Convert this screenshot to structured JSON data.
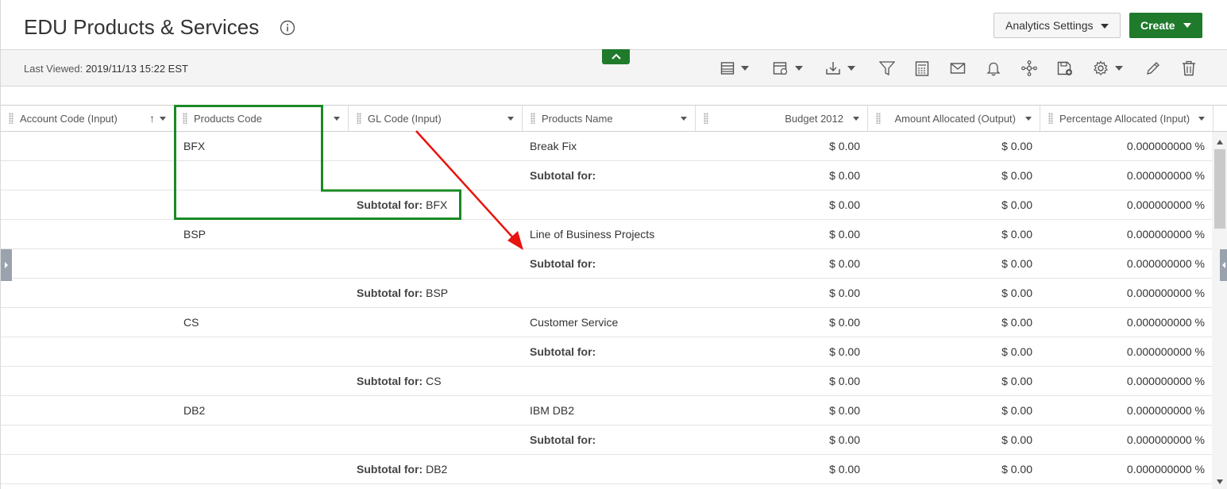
{
  "header": {
    "title": "EDU Products & Services",
    "analytics_label": "Analytics Settings",
    "create_label": "Create"
  },
  "toolbar": {
    "last_viewed_label": "Last Viewed:",
    "last_viewed_value": "2019/11/13 15:22 EST",
    "icons": [
      "table-view-icon",
      "report-view-icon",
      "download-icon",
      "filter-icon",
      "calculator-icon",
      "email-icon",
      "bell-icon",
      "hierarchy-icon",
      "save-icon",
      "gear-icon",
      "pencil-icon",
      "trash-icon"
    ]
  },
  "columns": [
    {
      "label": "Account Code (Input)"
    },
    {
      "label": "Products Code"
    },
    {
      "label": "GL Code (Input)"
    },
    {
      "label": "Products Name"
    },
    {
      "label": "Budget 2012"
    },
    {
      "label": "Amount Allocated (Output)"
    },
    {
      "label": "Percentage Allocated (Input)"
    }
  ],
  "rows": [
    {
      "prod": "BFX",
      "gl_label": "",
      "gl_value": "",
      "name": "Break Fix",
      "name_bold": false,
      "budget": "$ 0.00",
      "amount": "$ 0.00",
      "pct": "0.000000000 %"
    },
    {
      "prod": "",
      "gl_label": "",
      "gl_value": "",
      "name": "Subtotal for:",
      "name_bold": true,
      "budget": "$ 0.00",
      "amount": "$ 0.00",
      "pct": "0.000000000 %"
    },
    {
      "prod": "",
      "gl_label": "Subtotal for:",
      "gl_value": " BFX",
      "name": "",
      "name_bold": false,
      "budget": "$ 0.00",
      "amount": "$ 0.00",
      "pct": "0.000000000 %"
    },
    {
      "prod": "BSP",
      "gl_label": "",
      "gl_value": "",
      "name": "Line of Business Projects",
      "name_bold": false,
      "budget": "$ 0.00",
      "amount": "$ 0.00",
      "pct": "0.000000000 %"
    },
    {
      "prod": "",
      "gl_label": "",
      "gl_value": "",
      "name": "Subtotal for:",
      "name_bold": true,
      "budget": "$ 0.00",
      "amount": "$ 0.00",
      "pct": "0.000000000 %"
    },
    {
      "prod": "",
      "gl_label": "Subtotal for:",
      "gl_value": " BSP",
      "name": "",
      "name_bold": false,
      "budget": "$ 0.00",
      "amount": "$ 0.00",
      "pct": "0.000000000 %"
    },
    {
      "prod": "CS",
      "gl_label": "",
      "gl_value": "",
      "name": "Customer Service",
      "name_bold": false,
      "budget": "$ 0.00",
      "amount": "$ 0.00",
      "pct": "0.000000000 %"
    },
    {
      "prod": "",
      "gl_label": "",
      "gl_value": "",
      "name": "Subtotal for:",
      "name_bold": true,
      "budget": "$ 0.00",
      "amount": "$ 0.00",
      "pct": "0.000000000 %"
    },
    {
      "prod": "",
      "gl_label": "Subtotal for:",
      "gl_value": " CS",
      "name": "",
      "name_bold": false,
      "budget": "$ 0.00",
      "amount": "$ 0.00",
      "pct": "0.000000000 %"
    },
    {
      "prod": "DB2",
      "gl_label": "",
      "gl_value": "",
      "name": "IBM DB2",
      "name_bold": false,
      "budget": "$ 0.00",
      "amount": "$ 0.00",
      "pct": "0.000000000 %"
    },
    {
      "prod": "",
      "gl_label": "",
      "gl_value": "",
      "name": "Subtotal for:",
      "name_bold": true,
      "budget": "$ 0.00",
      "amount": "$ 0.00",
      "pct": "0.000000000 %"
    },
    {
      "prod": "",
      "gl_label": "Subtotal for:",
      "gl_value": " DB2",
      "name": "",
      "name_bold": false,
      "budget": "$ 0.00",
      "amount": "$ 0.00",
      "pct": "0.000000000 %"
    }
  ],
  "colors": {
    "accent_green": "#1f7a2c",
    "annotation_green": "#1a8a24",
    "annotation_red": "#e8140f"
  }
}
